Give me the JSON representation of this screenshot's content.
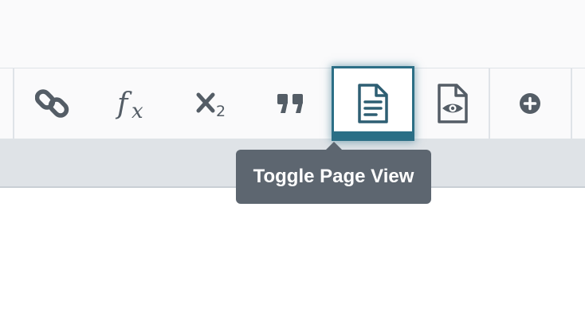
{
  "toolbar": {
    "buttons": [
      {
        "name": "link",
        "icon": "link-icon"
      },
      {
        "name": "formula",
        "icon": "function-icon",
        "glyph_main": "f",
        "glyph_sub": "x"
      },
      {
        "name": "subscript",
        "icon": "subscript-icon",
        "glyph_main": "×",
        "glyph_sub": "2"
      },
      {
        "name": "blockquote",
        "icon": "quote-icon"
      },
      {
        "name": "toggle-page-view",
        "icon": "document-icon",
        "active": true
      },
      {
        "name": "preview",
        "icon": "document-eye-icon"
      },
      {
        "name": "insert",
        "icon": "plus-circle-icon"
      }
    ]
  },
  "tooltip": {
    "text": "Toggle Page View"
  },
  "colors": {
    "icon": "#545d66",
    "accent": "#2a6f86",
    "tooltip_bg": "#5d6670",
    "toolbar_bg": "#fafafb",
    "strip_bg": "#dfe3e7"
  }
}
